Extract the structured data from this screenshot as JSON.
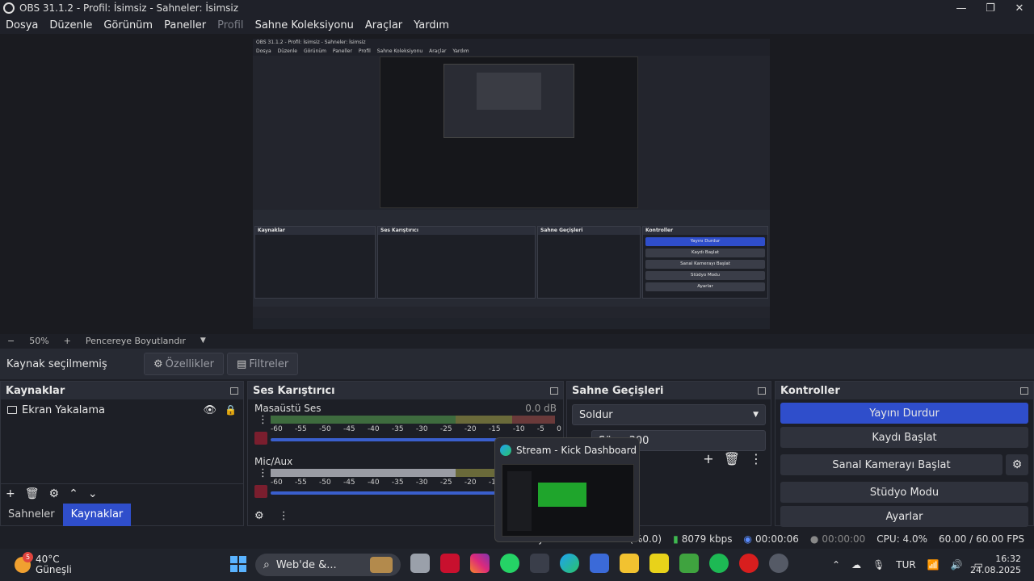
{
  "window": {
    "title": "OBS 31.1.2 - Profil: İsimsiz - Sahneler: İsimsiz",
    "minimize": "—",
    "maximize": "❐",
    "close": "✕"
  },
  "menu": [
    "Dosya",
    "Düzenle",
    "Görünüm",
    "Paneller",
    "Profil",
    "Sahne Koleksiyonu",
    "Araçlar",
    "Yardım"
  ],
  "preview": {
    "inner_title": "OBS 31.1.2 - Profil: İsimsiz - Sahneler: İsimsiz",
    "inner_menu": [
      "Dosya",
      "Düzenle",
      "Görünüm",
      "Paneller",
      "Profil",
      "Sahne Koleksiyonu",
      "Araçlar",
      "Yardım"
    ],
    "inner_sources_head": "Kaynaklar",
    "inner_mixer_head": "Ses Karıştırıcı",
    "inner_trans_head": "Sahne Geçişleri",
    "inner_ctrl_head": "Kontroller",
    "inner_stop": "Yayını Durdur",
    "inner_rec": "Kaydı Başlat",
    "inner_vcam": "Sanal Kamerayı Başlat",
    "inner_studio": "Stüdyo Modu",
    "inner_settings": "Ayarlar"
  },
  "zoom": {
    "minus": "−",
    "value": "50%",
    "plus": "+",
    "fit_label": "Pencereye Boyutlandır"
  },
  "source_toolbar": {
    "status": "Kaynak seçilmemiş",
    "properties": "Özellikler",
    "filters": "Filtreler"
  },
  "sources": {
    "title": "Kaynaklar",
    "items": [
      {
        "name": "Ekran Yakalama"
      }
    ]
  },
  "tabs": {
    "scenes": "Sahneler",
    "sources": "Kaynaklar"
  },
  "mixer": {
    "title": "Ses Karıştırıcı",
    "channels": [
      {
        "name": "Masaüstü Ses",
        "db": "0.0 dB"
      },
      {
        "name": "Mic/Aux",
        "db": ""
      }
    ],
    "ticks": [
      "-60",
      "-55",
      "-50",
      "-45",
      "-40",
      "-35",
      "-30",
      "-25",
      "-20",
      "-15",
      "-10",
      "-5",
      "0"
    ]
  },
  "transitions": {
    "title": "Sahne Geçişleri",
    "selected": "Soldur",
    "duration_label": "Süre",
    "duration_value": "300"
  },
  "controls": {
    "title": "Kontroller",
    "stop_stream": "Yayını Durdur",
    "start_recording": "Kaydı Başlat",
    "start_vcam": "Sanal Kamerayı Başlat",
    "studio_mode": "Stüdyo Modu",
    "settings": "Ayarlar"
  },
  "status": {
    "dropped": "Kaybedilen Kareler 0 (%0.0)",
    "bitrate": "8079 kbps",
    "stream_time": "00:00:06",
    "rec_time": "00:00:00",
    "cpu": "CPU: 4.0%",
    "fps": "60.00 / 60.00 FPS"
  },
  "popup": {
    "title": "Stream - Kick Dashboard ve..."
  },
  "taskbar": {
    "badge": "5",
    "temp": "40°C",
    "weather": "Güneşli",
    "search": "Web'de &...",
    "lang": "TUR",
    "time": "16:32",
    "date": "24.08.2025"
  },
  "colors": {
    "accent": "#2f4ecb",
    "panel": "#1d1f26",
    "header": "#2a2d37"
  }
}
